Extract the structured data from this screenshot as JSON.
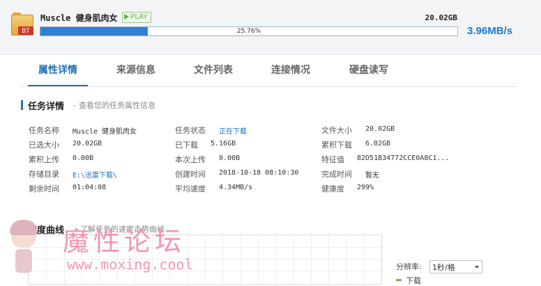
{
  "task": {
    "name": "Muscle 健身肌肉女",
    "badge": "PLAY",
    "file_icon_label": "BT",
    "total_size": "20.02GB",
    "progress_percent": 25.76,
    "progress_text": "25.76%",
    "speed": "3.96MB/s"
  },
  "tabs": [
    {
      "label": "属性详情",
      "active": true
    },
    {
      "label": "来源信息",
      "active": false
    },
    {
      "label": "文件列表",
      "active": false
    },
    {
      "label": "连接情况",
      "active": false
    },
    {
      "label": "硬盘读写",
      "active": false
    }
  ],
  "details_section": {
    "title": "任务详情",
    "subtitle": "– 查看您的任务属性信息"
  },
  "details": {
    "col1": [
      {
        "label": "任务名称",
        "value": "Muscle 健身肌肉女"
      },
      {
        "label": "已选大小",
        "value": "20.02GB"
      },
      {
        "label": "累积上传",
        "value": "0.00B"
      },
      {
        "label": "存储目录",
        "value": "E:\\迅雷下载\\"
      },
      {
        "label": "剩余时间",
        "value": "01:04:08"
      }
    ],
    "col2": [
      {
        "label": "任务状态",
        "value": "正在下载"
      },
      {
        "label": "已下载",
        "value": "5.16GB"
      },
      {
        "label": "本次上传",
        "value": "0.00B"
      },
      {
        "label": "创建时间",
        "value": "2018-10-18 08:10:30"
      },
      {
        "label": "平均速度",
        "value": "4.34MB/s"
      }
    ],
    "col3": [
      {
        "label": "文件大小",
        "value": "20.02GB"
      },
      {
        "label": "累积下载",
        "value": "6.02GB"
      },
      {
        "label": "特征值",
        "value": "82D51B34772CCE0A8C1..."
      },
      {
        "label": "完成时间",
        "value": "暂无"
      },
      {
        "label": "健康度",
        "value": "299%"
      }
    ]
  },
  "speed_section": {
    "title": "速度曲线",
    "subtitle": "– 了解任务的速度走势曲线"
  },
  "resolution": {
    "label": "分辨率:",
    "selected": "1秒/格"
  },
  "legend": {
    "download": "下载"
  },
  "watermark": {
    "logo_text": "魔性论坛",
    "url": "www.moxing.cool"
  },
  "colors": {
    "accent": "#1d6fb8",
    "progress_fill": "#2f81d4",
    "speed_text": "#1f77c8",
    "download_line": "#6cbf3a",
    "watermark_pink": "#f08cab"
  }
}
